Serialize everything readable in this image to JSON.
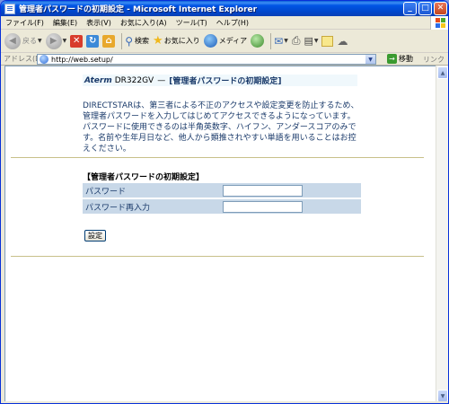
{
  "window": {
    "title": "管理者パスワードの初期設定 - Microsoft Internet Explorer",
    "buttons": {
      "minimize": "_",
      "maximize": "□",
      "close": "✕"
    }
  },
  "menu": [
    "ファイル(F)",
    "編集(E)",
    "表示(V)",
    "お気に入り(A)",
    "ツール(T)",
    "ヘルプ(H)"
  ],
  "toolbar": {
    "back": "戻る",
    "search": "検索",
    "favorites": "お気に入り",
    "media": "メディア"
  },
  "address": {
    "label": "アドレス(D)",
    "url": "http://web.setup/",
    "go": "移動",
    "links": "リンク"
  },
  "page": {
    "brand": "Aterm",
    "model": "DR322GV",
    "dash": "—",
    "title": "[管理者パスワードの初期設定]",
    "description": "DIRECTSTARは、第三者による不正のアクセスや設定変更を防止するため、管理者パスワードを入力してはじめてアクセスできるようになっています。パスワードに使用できるのは半角英数字、ハイフン、アンダースコアのみです。名前や生年月日など、他人から類推されやすい単語を用いることはお控えください。",
    "section_title": "【管理者パスワードの初期設定】",
    "fields": [
      {
        "label": "パスワード",
        "value": ""
      },
      {
        "label": "パスワード再入力",
        "value": ""
      }
    ],
    "submit": "設定"
  },
  "colors": {
    "titlebar": "#0055e5",
    "form_bg": "#c8d8e8",
    "divider": "#c8c08a",
    "text_blue": "#1a3a6a"
  }
}
